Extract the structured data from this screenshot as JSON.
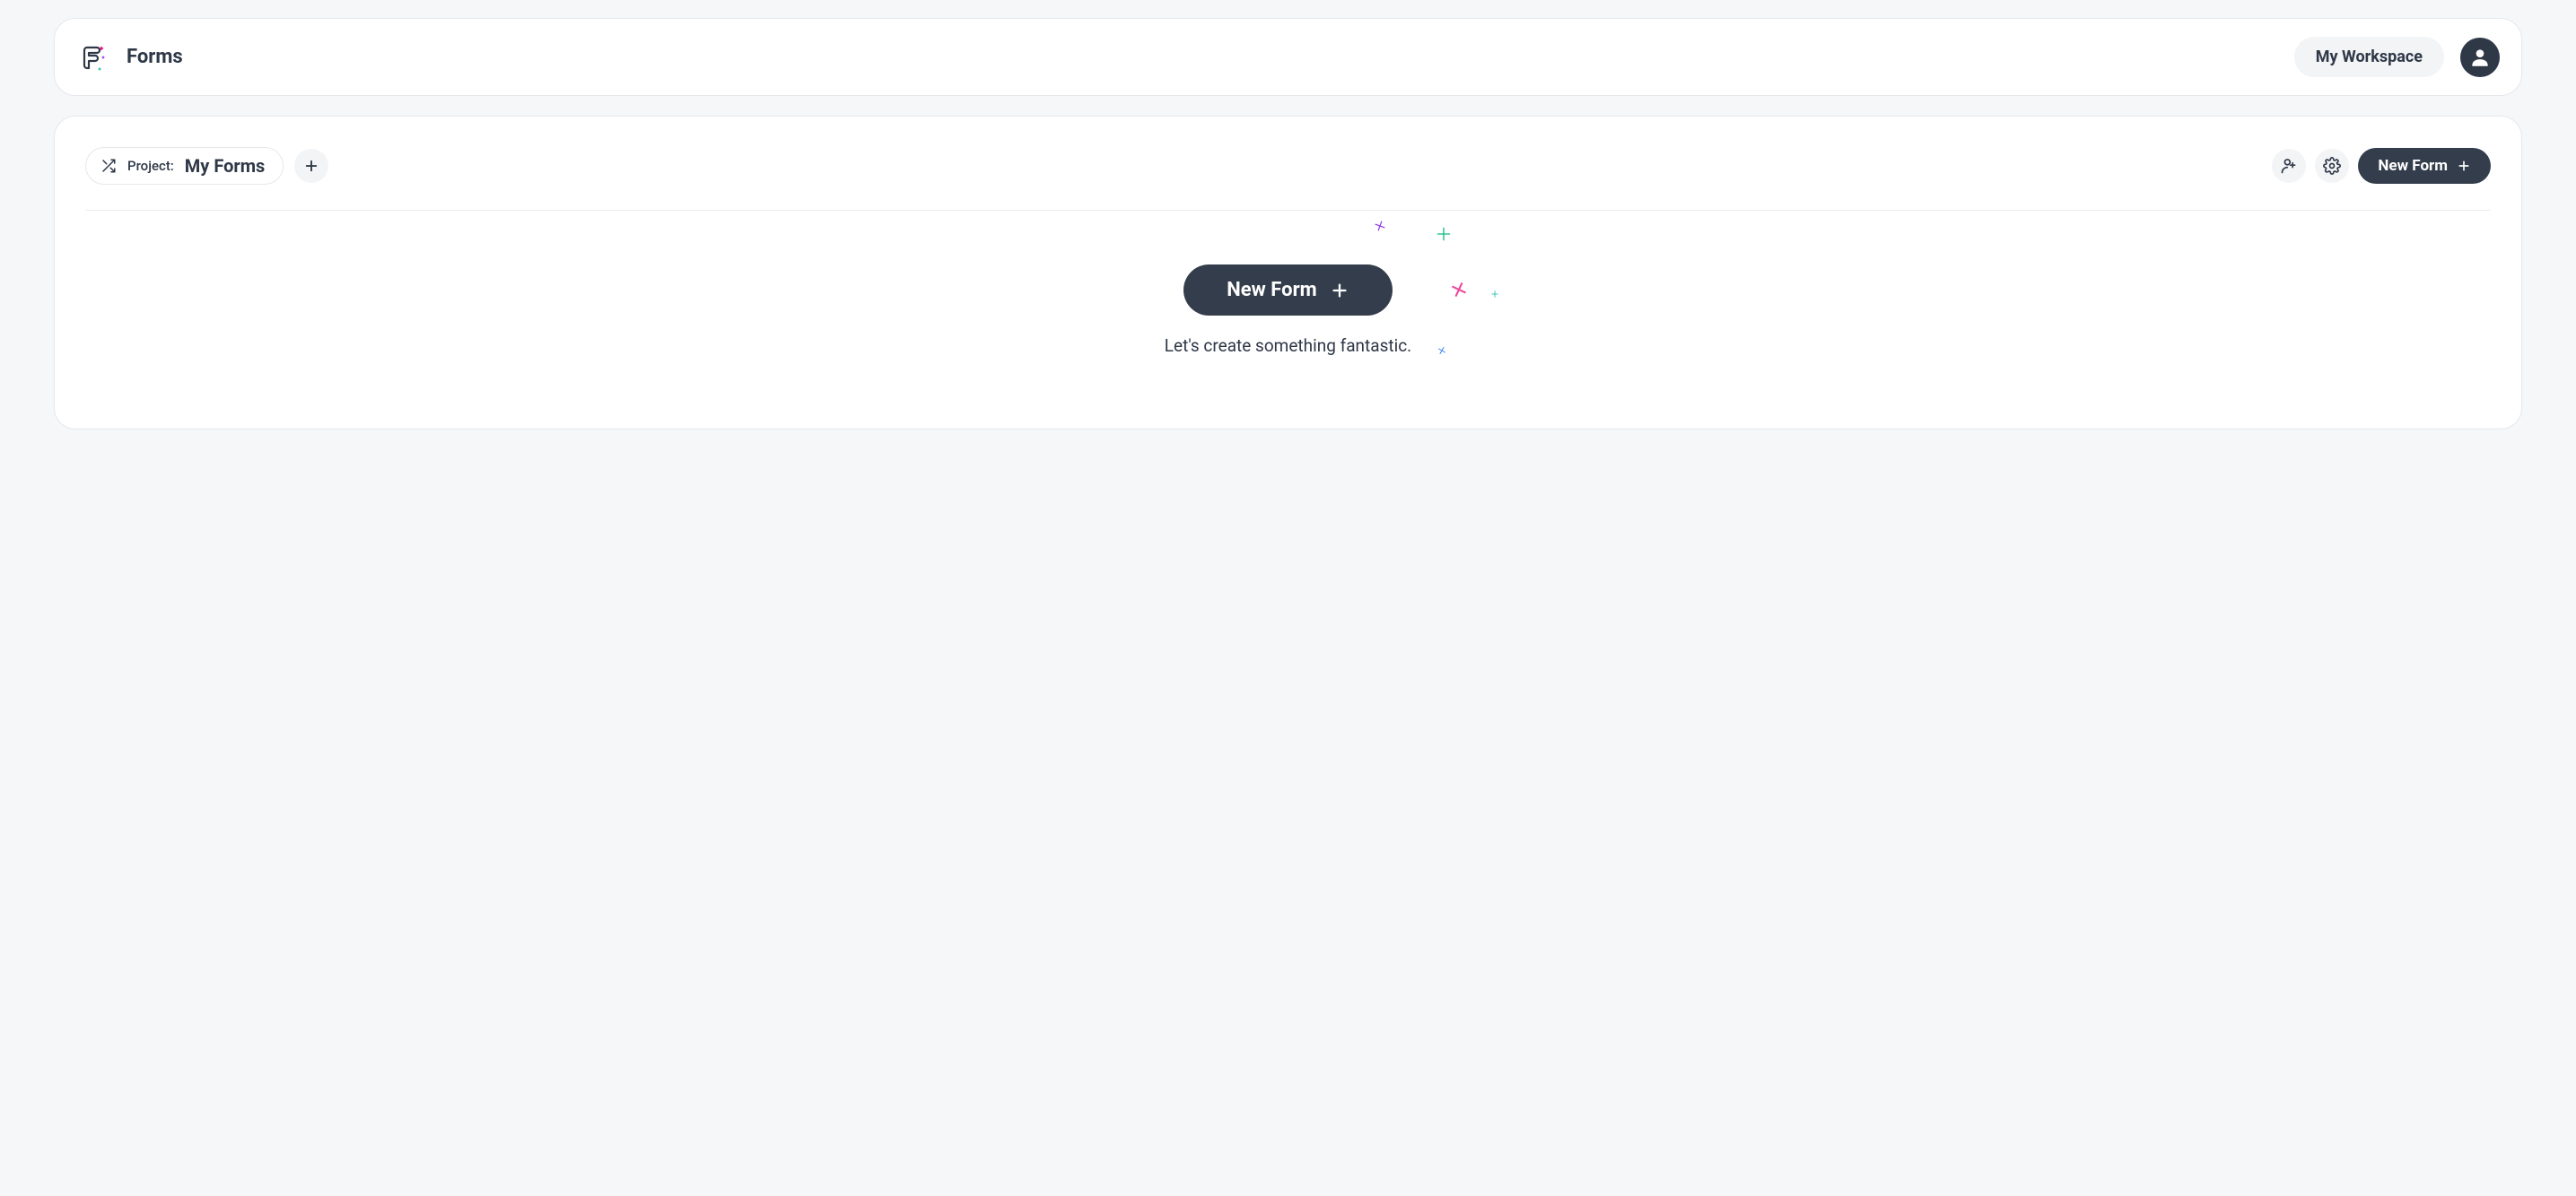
{
  "header": {
    "brand": "Forms",
    "workspace_label": "My Workspace"
  },
  "toolbar": {
    "project_prefix": "Project:",
    "project_name": "My Forms",
    "new_form_label": "New Form"
  },
  "empty_state": {
    "cta_label": "New Form",
    "tagline": "Let's create something fantastic."
  }
}
